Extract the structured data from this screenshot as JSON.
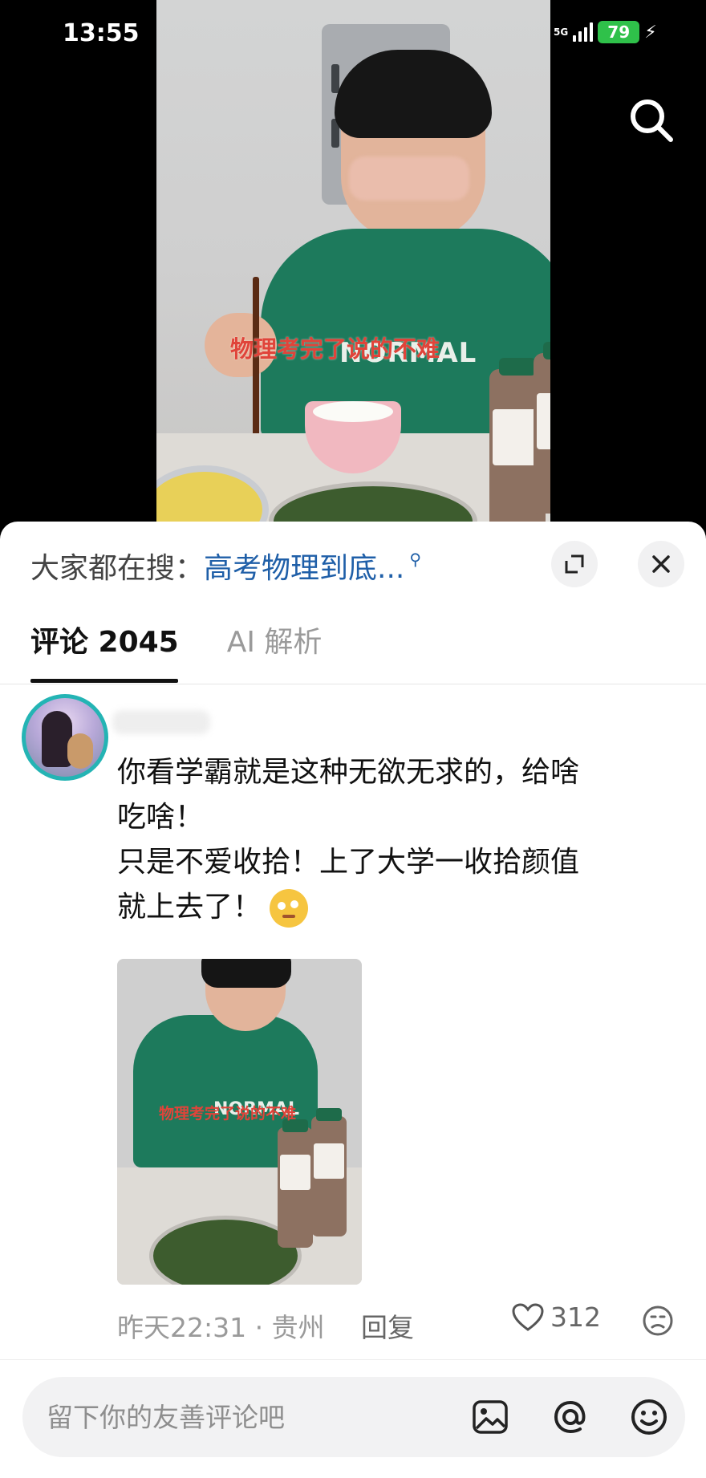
{
  "status_bar": {
    "time": "13:55",
    "network": "5G",
    "battery": "79"
  },
  "video": {
    "caption": "物理考完了说的不难",
    "shirt_print": "NORMAL"
  },
  "sheet": {
    "hot_search": {
      "label": "大家都在搜：",
      "query": "高考物理到底..."
    },
    "tabs": [
      {
        "label": "评论 2045",
        "active": true
      },
      {
        "label": "AI 解析",
        "active": false
      }
    ],
    "comment": {
      "lines": [
        "你看学霸就是这种无欲无求的，给啥\n吃啥！",
        "只是不爱收拾！上了大学一收拾颜值\n就上去了！"
      ],
      "emoji": "thinking-face-emoji",
      "image": {
        "caption": "物理考完了说的不难",
        "shirt_print": "NORMAL"
      },
      "time_location": "昨天22:31 · 贵州",
      "reply_label": "回复",
      "like_count": "312"
    },
    "input": {
      "placeholder": "留下你的友善评论吧"
    }
  },
  "colors": {
    "accent_link": "#1f5fa8",
    "avatar_ring": "#24b4b4",
    "battery": "#2fc14a",
    "caption_red": "#e0443a"
  }
}
